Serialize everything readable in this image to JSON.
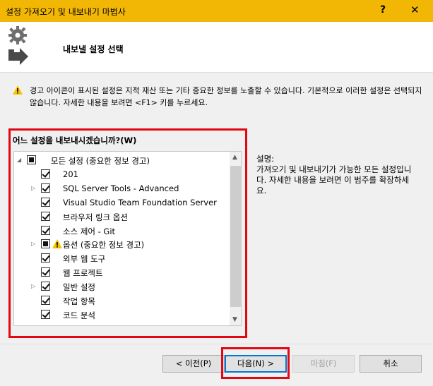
{
  "window": {
    "title": "설정 가져오기 및 내보내기 마법사",
    "help_label": "?",
    "close_label": "✕"
  },
  "header": {
    "heading": "내보낼 설정 선택"
  },
  "warning": {
    "text": "경고 아이콘이 표시된 설정은 지적 재산 또는 기타 중요한 정보를 노출할 수 있습니다. 기본적으로 이러한 설정은 선택되지 않습니다. 자세한 내용을 보려면 <F1> 키를 누르세요."
  },
  "settings_panel": {
    "title": "어느 설정을 내보내시겠습니까?(W)",
    "tree": [
      {
        "label": "모든 설정 (중요한 정보 경고)",
        "state": "partial",
        "expander": "expanded",
        "level": 0,
        "warning": false
      },
      {
        "label": "201",
        "state": "checked",
        "expander": "none",
        "level": 1,
        "warning": false
      },
      {
        "label": "SQL Server Tools - Advanced",
        "state": "checked",
        "expander": "collapsed",
        "level": 1,
        "warning": false
      },
      {
        "label": "Visual Studio Team Foundation Server",
        "state": "checked",
        "expander": "none",
        "level": 1,
        "warning": false
      },
      {
        "label": "브라우저 링크 옵션",
        "state": "checked",
        "expander": "none",
        "level": 1,
        "warning": false
      },
      {
        "label": "소스 제어 - Git",
        "state": "checked",
        "expander": "none",
        "level": 1,
        "warning": false
      },
      {
        "label": "옵션 (중요한 정보 경고)",
        "state": "partial",
        "expander": "collapsed",
        "level": 1,
        "warning": true
      },
      {
        "label": "외부 웹 도구",
        "state": "checked",
        "expander": "none",
        "level": 1,
        "warning": false
      },
      {
        "label": "웹 프로젝트",
        "state": "checked",
        "expander": "none",
        "level": 1,
        "warning": false
      },
      {
        "label": "일반 설정",
        "state": "checked",
        "expander": "collapsed",
        "level": 1,
        "warning": false
      },
      {
        "label": "작업 항목",
        "state": "checked",
        "expander": "none",
        "level": 1,
        "warning": false
      },
      {
        "label": "코드 분석",
        "state": "checked",
        "expander": "none",
        "level": 1,
        "warning": false
      }
    ]
  },
  "description": {
    "title": "설명:",
    "text": "가져오기 및 내보내기가 가능한 모든 설정입니다. 자세한 내용을 보려면 이 범주를 확장하세요."
  },
  "buttons": {
    "back": "< 이전(P)",
    "next": "다음(N) >",
    "finish": "마침(F)",
    "cancel": "취소"
  },
  "colors": {
    "titlebar": "#f2b705",
    "highlight_frame": "#e30613",
    "primary_border": "#0078d7"
  }
}
